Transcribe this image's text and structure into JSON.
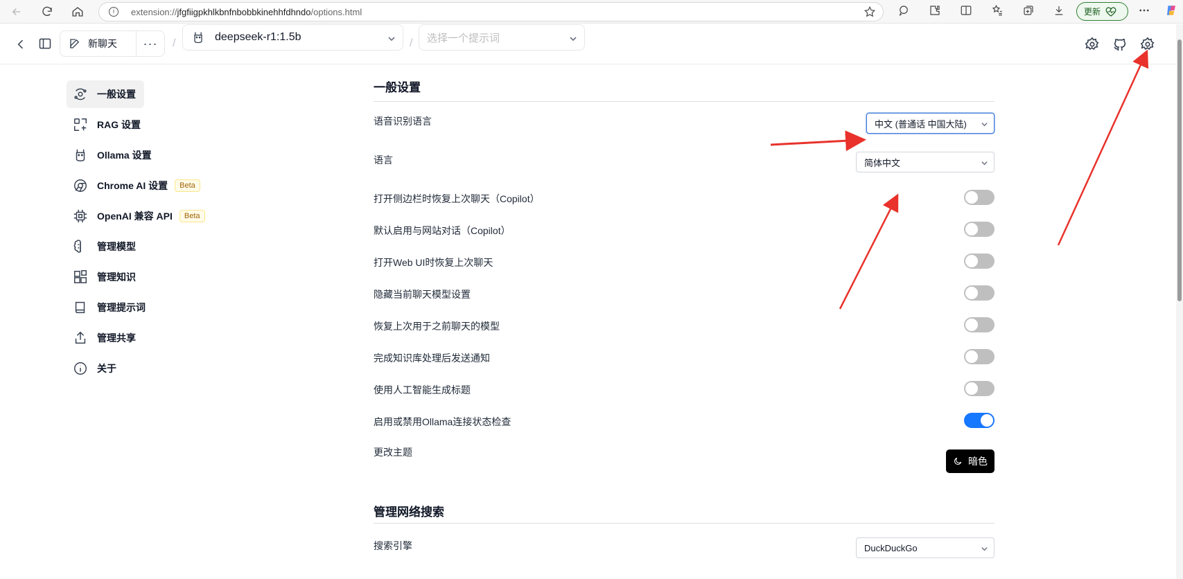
{
  "browser": {
    "url_prefix": "extension://",
    "url_host": "jfgfiigpkhlkbnfnbobbkinehhfdhndo",
    "url_path": "/options.html",
    "update_label": "更新"
  },
  "header": {
    "new_chat_label": "新聊天",
    "more_label": "···",
    "separator": "/",
    "model_value": "deepseek-r1:1.5b",
    "prompt_placeholder": "选择一个提示词"
  },
  "sidebar": {
    "items": [
      {
        "label": "一般设置",
        "icon": "orbit-icon",
        "active": true
      },
      {
        "label": "RAG 设置",
        "icon": "scan-icon"
      },
      {
        "label": "Ollama 设置",
        "icon": "llama-icon"
      },
      {
        "label": "Chrome AI 设置",
        "icon": "chrome-icon",
        "badge": "Beta"
      },
      {
        "label": "OpenAI 兼容 API",
        "icon": "chip-icon",
        "badge": "Beta"
      },
      {
        "label": "管理模型",
        "icon": "brain-icon"
      },
      {
        "label": "管理知识",
        "icon": "blocks-icon"
      },
      {
        "label": "管理提示词",
        "icon": "book-icon"
      },
      {
        "label": "管理共享",
        "icon": "share-icon"
      },
      {
        "label": "关于",
        "icon": "info-icon"
      }
    ]
  },
  "general": {
    "title": "一般设置",
    "speech_lang_label": "语音识别语言",
    "speech_lang_value": "中文 (普通话 中国大陆)",
    "language_label": "语言",
    "language_value": "简体中文",
    "toggles": [
      {
        "label": "打开侧边栏时恢复上次聊天（Copilot）",
        "on": false
      },
      {
        "label": "默认启用与网站对话（Copilot）",
        "on": false
      },
      {
        "label": "打开Web UI时恢复上次聊天",
        "on": false
      },
      {
        "label": "隐藏当前聊天模型设置",
        "on": false
      },
      {
        "label": "恢复上次用于之前聊天的模型",
        "on": false
      },
      {
        "label": "完成知识库处理后发送通知",
        "on": false
      },
      {
        "label": "使用人工智能生成标题",
        "on": false
      },
      {
        "label": "启用或禁用Ollama连接状态检查",
        "on": true
      }
    ],
    "theme_label": "更改主题",
    "theme_button": "暗色"
  },
  "web_search": {
    "title": "管理网络搜索",
    "engine_label": "搜索引擎",
    "engine_value": "DuckDuckGo"
  },
  "colors": {
    "toggle_on": "#1677ff",
    "toggle_off": "#bfbfbf",
    "annotation_arrow": "#e8322b",
    "beta_badge": "#a16207"
  }
}
